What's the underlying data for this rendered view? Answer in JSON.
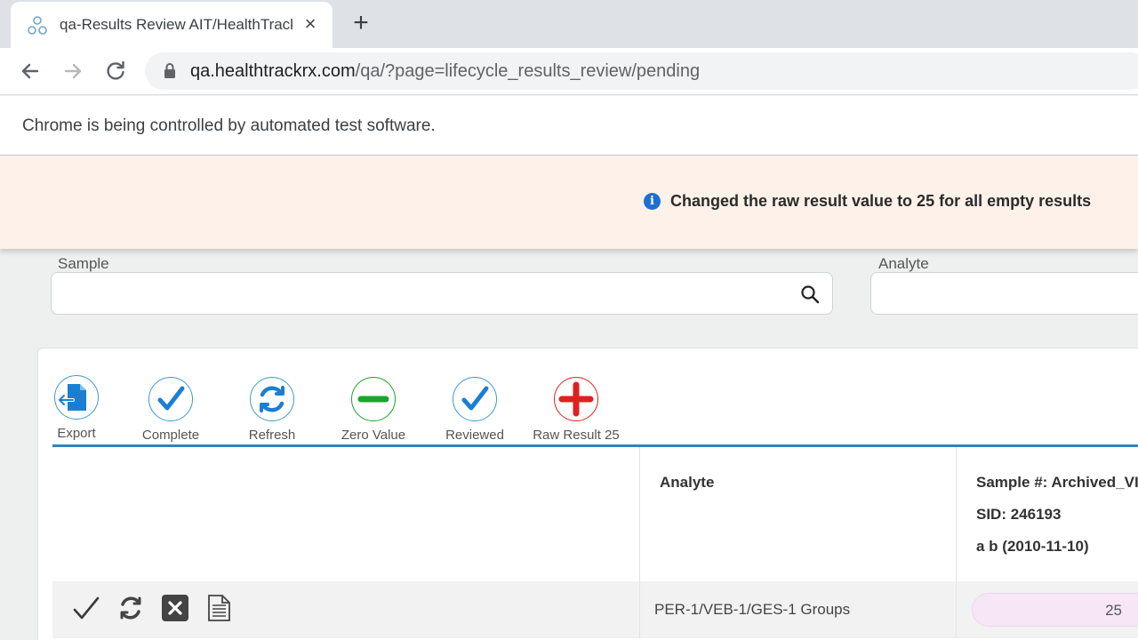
{
  "browser": {
    "tab_title": "qa-Results Review AIT/HealthTrackRx",
    "url_host": "qa.healthtrackrx.com",
    "url_path": "/qa/?page=lifecycle_results_review/pending",
    "infobar_text": "Chrome is being controlled by automated test software."
  },
  "notification": {
    "message": "Changed the raw result value to 25 for all empty results",
    "icon": "info-icon"
  },
  "filters": {
    "sample_label": "Sample",
    "sample_value": "",
    "analyte_label": "Analyte",
    "analyte_value": ""
  },
  "actions": [
    {
      "label": "Export",
      "icon": "export-icon",
      "color": "#1a7fd4"
    },
    {
      "label": "Complete",
      "icon": "check-icon",
      "color": "#1a7fd4"
    },
    {
      "label": "Refresh",
      "icon": "refresh-icon",
      "color": "#1a7fd4"
    },
    {
      "label": "Zero Value",
      "icon": "minus-icon",
      "color": "#1aa52a"
    },
    {
      "label": "Reviewed",
      "icon": "check-icon",
      "color": "#1a7fd4"
    },
    {
      "label": "Raw Result 25",
      "icon": "plus-icon",
      "color": "#e02020"
    }
  ],
  "table": {
    "col_analyte": "Analyte",
    "sample_header": {
      "line1": "Sample #: Archived_VI",
      "line2": "SID: 246193",
      "line3": "a b (2010-11-10)"
    },
    "rows": [
      {
        "analyte": "PER-1/VEB-1/GES-1 Groups",
        "result": "25",
        "row_icons": [
          "checkmark-icon",
          "refresh-icon",
          "close-icon",
          "document-icon"
        ]
      }
    ]
  },
  "colors": {
    "accent": "#2b85c0",
    "notification_bg": "#fdf1e9",
    "result_pill": "#f6e6f6"
  }
}
